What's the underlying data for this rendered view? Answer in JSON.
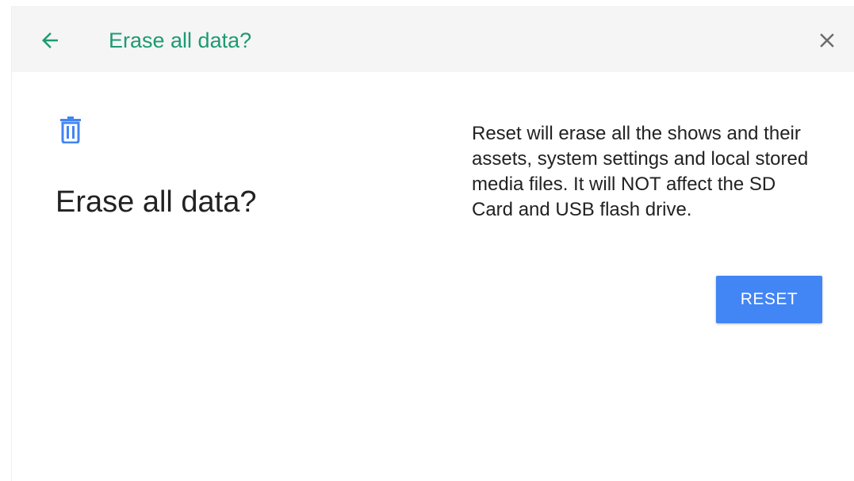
{
  "toolbar": {
    "title": "Erase all data?",
    "back_icon": "arrow-back-icon",
    "close_icon": "close-icon",
    "accent_color": "#1e9a72"
  },
  "main": {
    "icon": "trash-icon",
    "heading": "Erase all data?",
    "description": "Reset will erase all the shows and their assets, system settings and local stored media files. It will NOT affect the SD Card and USB flash drive.",
    "reset_label": "RESET",
    "button_color": "#4285f4"
  }
}
